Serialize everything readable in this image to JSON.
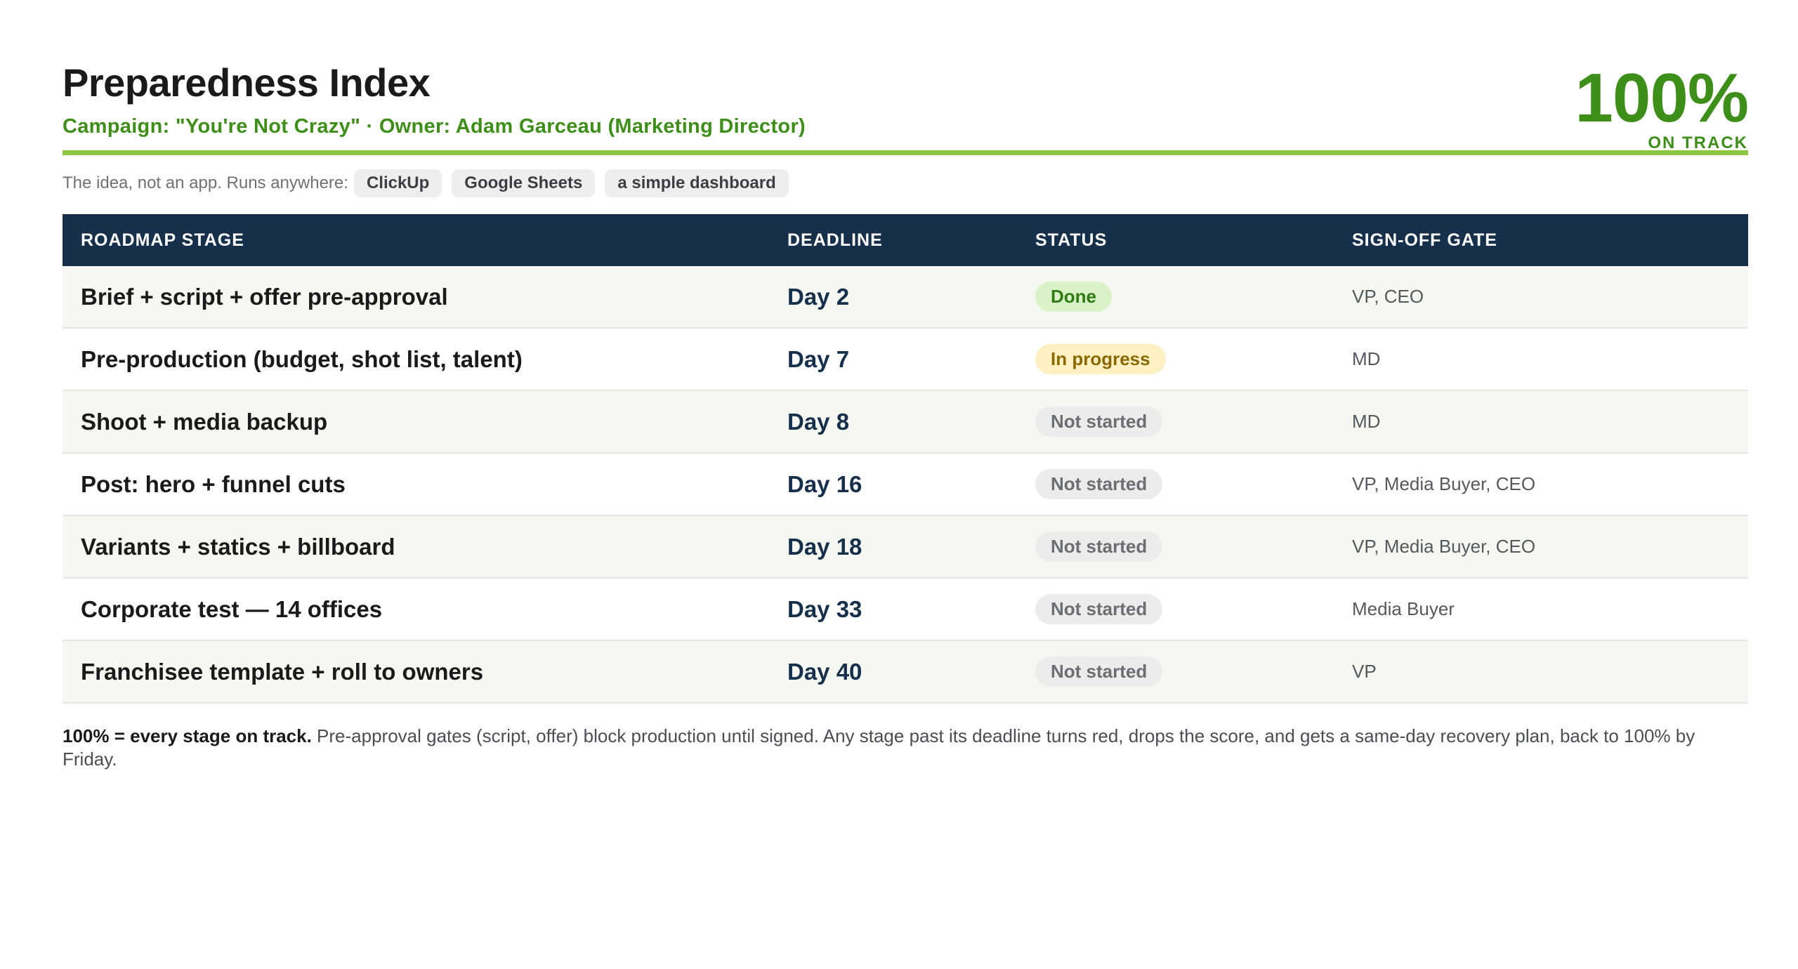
{
  "header": {
    "title": "Preparedness Index",
    "subtitle": "Campaign: \"You're Not Crazy\" · Owner: Adam Garceau (Marketing Director)",
    "score_value": "100%",
    "score_label": "ON TRACK"
  },
  "colors": {
    "accent_green": "#3e8e1a",
    "rule_green": "#8dc63f",
    "header_navy": "#16304b",
    "done_bg": "#d9f2c7",
    "in_progress_bg": "#fdf1c3",
    "not_started_bg": "#ececec"
  },
  "runs": {
    "intro": "The idea, not an app. Runs anywhere:",
    "chips": [
      "ClickUp",
      "Google Sheets",
      "a simple dashboard"
    ]
  },
  "table": {
    "columns": [
      "ROADMAP STAGE",
      "DEADLINE",
      "STATUS",
      "SIGN-OFF GATE"
    ],
    "rows": [
      {
        "stage": "Brief + script + offer pre-approval",
        "deadline": "Day 2",
        "status": "Done",
        "status_type": "done",
        "gate": "VP, CEO"
      },
      {
        "stage": "Pre-production (budget, shot list, talent)",
        "deadline": "Day 7",
        "status": "In progress",
        "status_type": "progress",
        "gate": "MD"
      },
      {
        "stage": "Shoot + media backup",
        "deadline": "Day 8",
        "status": "Not started",
        "status_type": "notstarted",
        "gate": "MD"
      },
      {
        "stage": "Post: hero + funnel cuts",
        "deadline": "Day 16",
        "status": "Not started",
        "status_type": "notstarted",
        "gate": "VP, Media Buyer, CEO"
      },
      {
        "stage": "Variants + statics + billboard",
        "deadline": "Day 18",
        "status": "Not started",
        "status_type": "notstarted",
        "gate": "VP, Media Buyer, CEO"
      },
      {
        "stage": "Corporate test — 14 offices",
        "deadline": "Day 33",
        "status": "Not started",
        "status_type": "notstarted",
        "gate": "Media Buyer"
      },
      {
        "stage": "Franchisee template + roll to owners",
        "deadline": "Day 40",
        "status": "Not started",
        "status_type": "notstarted",
        "gate": "VP"
      }
    ]
  },
  "footnote": {
    "bold": "100% = every stage on track.",
    "text": " Pre-approval gates (script, offer) block production until signed. Any stage past its deadline turns red, drops the score, and gets a same-day recovery plan, back to 100% by Friday."
  }
}
